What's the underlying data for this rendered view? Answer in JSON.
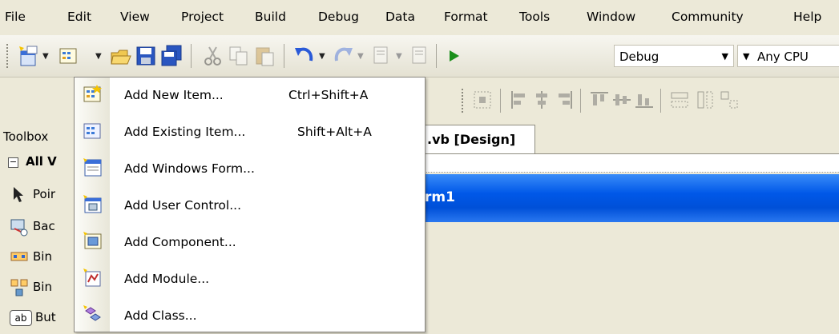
{
  "menubar": [
    "File",
    "Edit",
    "View",
    "Project",
    "Build",
    "Debug",
    "Data",
    "Format",
    "Tools",
    "Window",
    "Community",
    "Help"
  ],
  "toolbar": {
    "config_combo": "Debug",
    "platform_combo": "Any CPU"
  },
  "toolbox": {
    "title": "Toolbox",
    "group": "All V",
    "items": [
      "Poir",
      "Bac",
      "Bin",
      "Bin",
      "But"
    ],
    "button_glyph": "ab"
  },
  "document": {
    "tab_label": ".vb [Design]",
    "form_title": "rm1"
  },
  "add_menu": {
    "items": [
      {
        "label": "Add New Item...",
        "shortcut": "Ctrl+Shift+A",
        "icon": "new-item-icon"
      },
      {
        "label": "Add Existing Item...",
        "shortcut": "Shift+Alt+A",
        "icon": "existing-item-icon"
      },
      {
        "label": "Add Windows Form...",
        "shortcut": "",
        "icon": "windows-form-icon"
      },
      {
        "label": "Add User Control...",
        "shortcut": "",
        "icon": "user-control-icon"
      },
      {
        "label": "Add Component...",
        "shortcut": "",
        "icon": "component-icon"
      },
      {
        "label": "Add Module...",
        "shortcut": "",
        "icon": "module-icon"
      },
      {
        "label": "Add Class...",
        "shortcut": "",
        "icon": "class-icon"
      }
    ]
  },
  "colors": {
    "menu_bg": "#ece9d8",
    "form_title_bar": "#0058e8",
    "start_arrow": "#1a8f1a"
  }
}
